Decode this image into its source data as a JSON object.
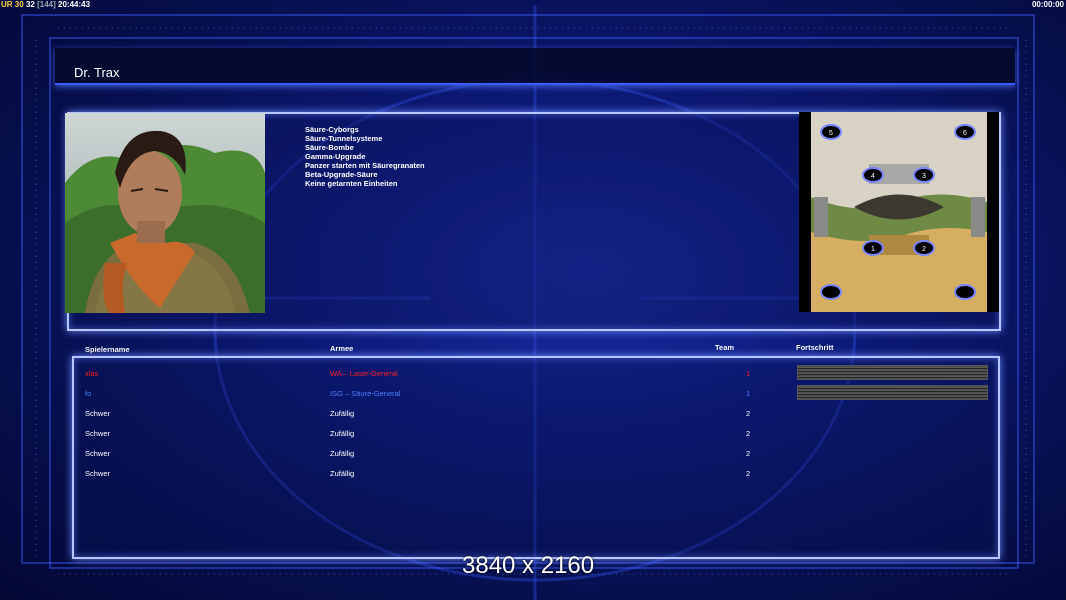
{
  "hud": {
    "ur": "UR",
    "fps": "30",
    "fps_b": "32",
    "cap": "[144]",
    "clock": "20:44:43",
    "timer": "00:00:00"
  },
  "header": {
    "title": "Dr. Trax"
  },
  "general": {
    "features": [
      "Säure-Cyborgs",
      "Säure-Tunnelsysteme",
      "Säure-Bombe",
      "Gamma-Upgrade",
      "Panzer starten mit Säuregranaten",
      "Beta-Upgrade-Säure",
      "Keine getarnten Einheiten"
    ]
  },
  "minimap": {
    "starts": [
      "5",
      "6",
      "4",
      "3",
      "1",
      "2",
      "",
      ""
    ]
  },
  "players": {
    "columns": {
      "name": "Spielername",
      "army": "Armee",
      "team": "Team",
      "progress": "Fortschritt"
    },
    "rows": [
      {
        "name": "xlas",
        "army": "WA – Laser-General",
        "team": "1",
        "color": "#ff2020",
        "progress": 1.0
      },
      {
        "name": "fo",
        "army": "ISG – Säure-General",
        "team": "1",
        "color": "#4e7dff",
        "progress": 1.0
      },
      {
        "name": "Schwer",
        "army": "Zufällig",
        "team": "2",
        "color": "#ffffff",
        "progress": null
      },
      {
        "name": "Schwer",
        "army": "Zufällig",
        "team": "2",
        "color": "#ffffff",
        "progress": null
      },
      {
        "name": "Schwer",
        "army": "Zufällig",
        "team": "2",
        "color": "#ffffff",
        "progress": null
      },
      {
        "name": "Schwer",
        "army": "Zufällig",
        "team": "2",
        "color": "#ffffff",
        "progress": null
      }
    ]
  },
  "overlay": {
    "resolution": "3840 x 2160"
  },
  "colors": {
    "accent": "#3a5cff",
    "panel_border": "#b8c6ff",
    "background": "#0d1a78"
  }
}
